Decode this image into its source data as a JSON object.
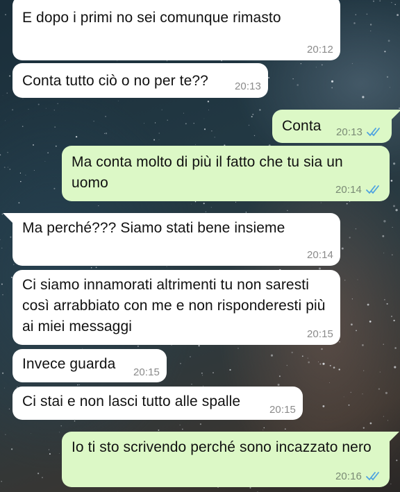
{
  "messages": [
    {
      "text": "E dopo i primi no sei comunque rimasto",
      "time": "20:12"
    },
    {
      "text": "Conta tutto ciò o no per te??",
      "time": "20:13"
    },
    {
      "text": "Conta",
      "time": "20:13"
    },
    {
      "text": "Ma conta molto di più il fatto che tu sia un uomo",
      "time": "20:14"
    },
    {
      "text": "Ma perché??? Siamo stati bene insieme",
      "time": "20:14"
    },
    {
      "text": "Ci siamo innamorati altrimenti tu non saresti così arrabbiato con me e non risponderesti più ai miei messaggi",
      "time": "20:15"
    },
    {
      "text": "Invece guarda",
      "time": "20:15"
    },
    {
      "text": "Ci stai e non lasci tutto alle spalle",
      "time": "20:15"
    },
    {
      "text": "Io ti sto scrivendo perché sono incazzato nero",
      "time": "20:16"
    }
  ],
  "colors": {
    "incoming_bubble": "#ffffff",
    "outgoing_bubble": "#dcf8c6",
    "read_check": "#4fa3e0"
  },
  "icons": {
    "read_receipt": "double-check-icon"
  }
}
